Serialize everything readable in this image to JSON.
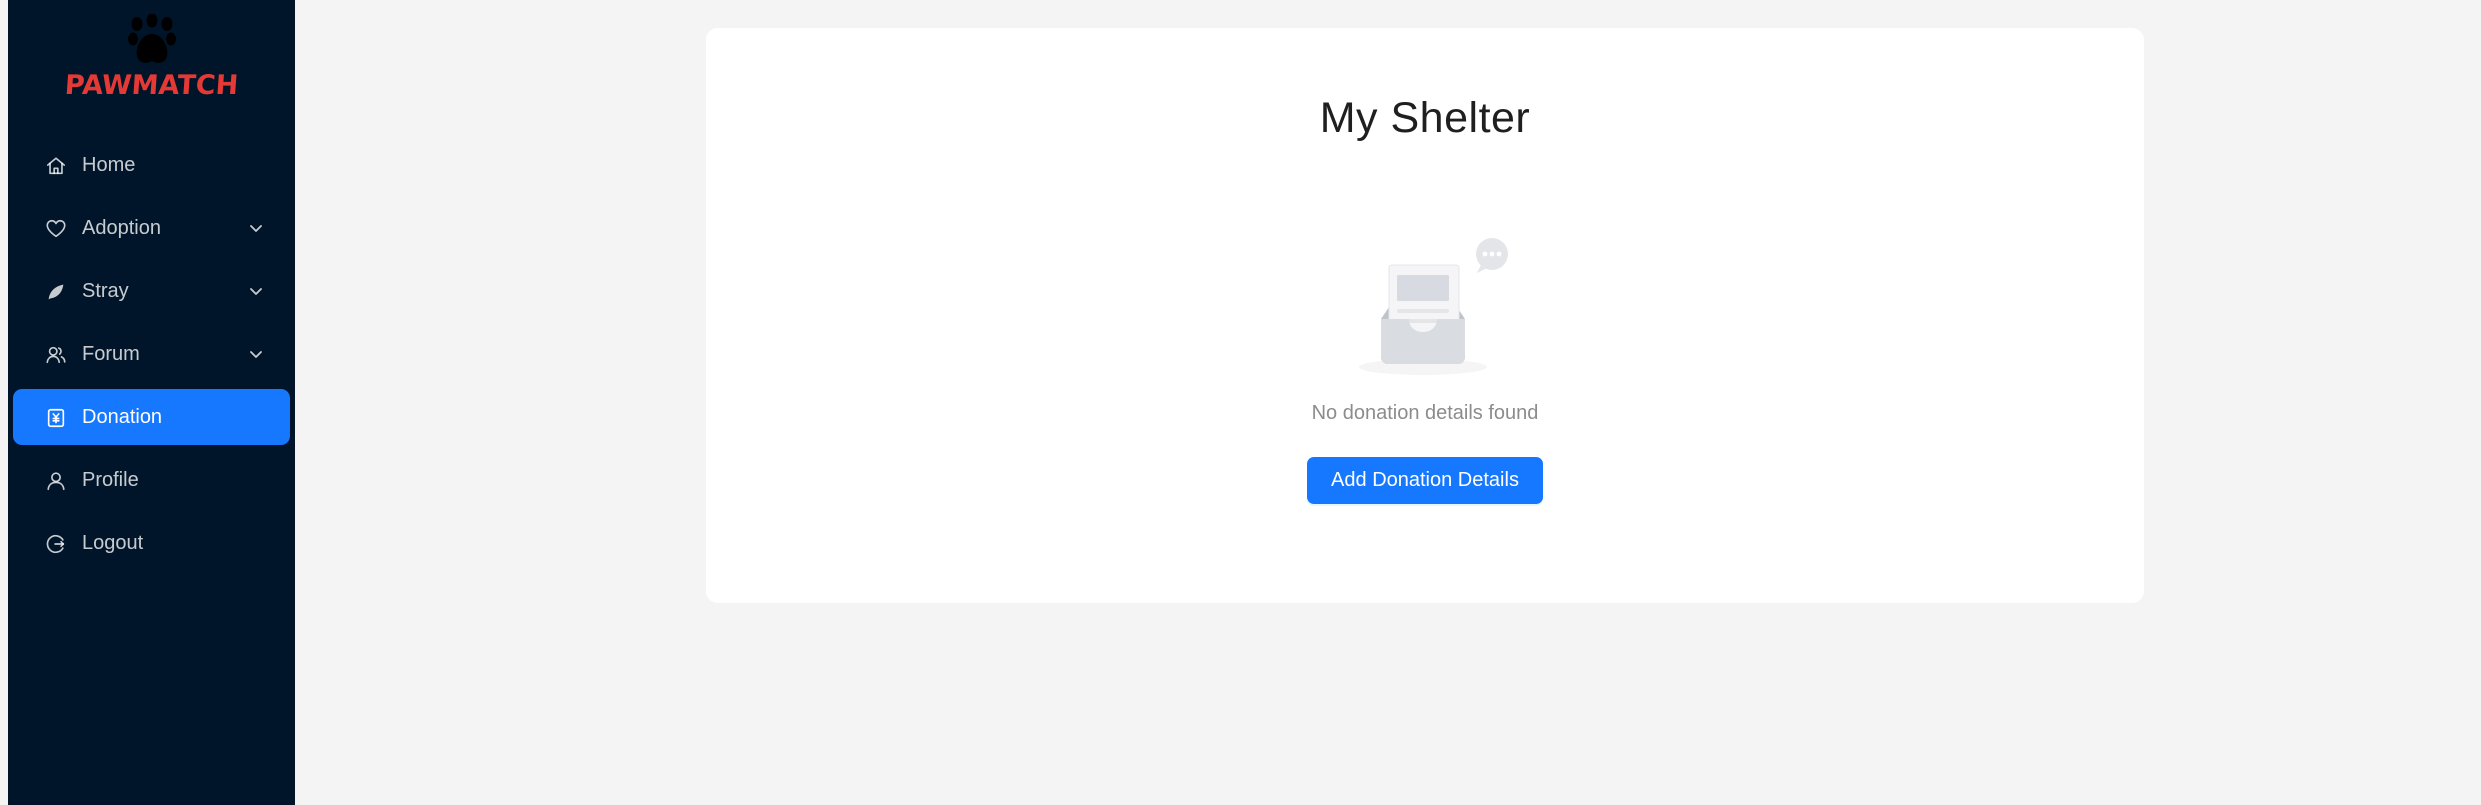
{
  "brand": {
    "name": "PAWMATCH",
    "color": "#e53935",
    "icon": "paw-icon"
  },
  "sidebar": {
    "background": "#001529",
    "active_color": "#1677ff",
    "items": [
      {
        "label": "Home",
        "icon": "home-icon",
        "has_submenu": false,
        "active": false
      },
      {
        "label": "Adoption",
        "icon": "heart-icon",
        "has_submenu": true,
        "active": false
      },
      {
        "label": "Stray",
        "icon": "leaf-icon",
        "has_submenu": true,
        "active": false
      },
      {
        "label": "Forum",
        "icon": "users-icon",
        "has_submenu": true,
        "active": false
      },
      {
        "label": "Donation",
        "icon": "donation-icon",
        "has_submenu": false,
        "active": true
      },
      {
        "label": "Profile",
        "icon": "user-icon",
        "has_submenu": false,
        "active": false
      },
      {
        "label": "Logout",
        "icon": "logout-icon",
        "has_submenu": false,
        "active": false
      }
    ]
  },
  "main": {
    "title": "My Shelter",
    "empty_state": {
      "icon": "empty-inbox-icon",
      "text": "No donation details found"
    },
    "add_button_label": "Add Donation Details"
  }
}
